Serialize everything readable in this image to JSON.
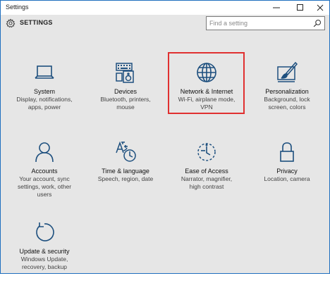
{
  "window": {
    "title": "Settings"
  },
  "header": {
    "label": "SETTINGS",
    "search_placeholder": "Find a setting"
  },
  "tiles": [
    {
      "name": "System",
      "desc1": "Display, notifications,",
      "desc2": "apps, power",
      "desc3": "",
      "icon": "laptop-icon"
    },
    {
      "name": "Devices",
      "desc1": "Bluetooth, printers,",
      "desc2": "mouse",
      "desc3": "",
      "icon": "devices-icon"
    },
    {
      "name": "Network & Internet",
      "desc1": "Wi-Fi, airplane mode,",
      "desc2": "VPN",
      "desc3": "",
      "icon": "globe-icon"
    },
    {
      "name": "Personalization",
      "desc1": "Background, lock",
      "desc2": "screen, colors",
      "desc3": "",
      "icon": "paint-icon"
    },
    {
      "name": "Accounts",
      "desc1": "Your account, sync",
      "desc2": "settings, work, other",
      "desc3": "users",
      "icon": "person-icon"
    },
    {
      "name": "Time & language",
      "desc1": "Speech, region, date",
      "desc2": "",
      "desc3": "",
      "icon": "time-language-icon"
    },
    {
      "name": "Ease of Access",
      "desc1": "Narrator, magnifier,",
      "desc2": "high contrast",
      "desc3": "",
      "icon": "ease-of-access-icon"
    },
    {
      "name": "Privacy",
      "desc1": "Location, camera",
      "desc2": "",
      "desc3": "",
      "icon": "lock-icon"
    },
    {
      "name": "Update & security",
      "desc1": "Windows Update,",
      "desc2": "recovery, backup",
      "desc3": "",
      "icon": "update-icon"
    }
  ],
  "colors": {
    "icon": "#1d4f7e",
    "highlight": "#e03030",
    "background": "#e6e6e6"
  }
}
